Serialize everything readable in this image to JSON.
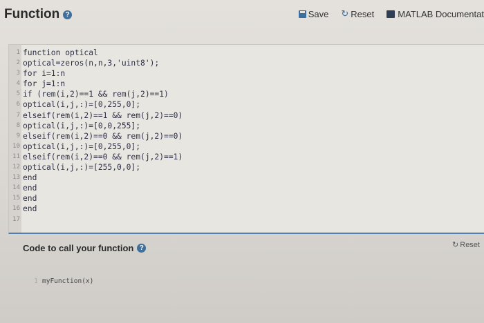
{
  "header": {
    "title": "Function",
    "save_label": "Save",
    "reset_label": "Reset",
    "doc_label": "MATLAB Documentat"
  },
  "editor": {
    "lines": [
      {
        "num": "1",
        "code": "function optical"
      },
      {
        "num": "2",
        "code": "optical=zeros(n,n,3,'uint8');"
      },
      {
        "num": "3",
        "code": "for i=1:n"
      },
      {
        "num": "4",
        "code": "for j=1:n"
      },
      {
        "num": "5",
        "code": "if (rem(i,2)==1 && rem(j,2)==1)"
      },
      {
        "num": "6",
        "code": "optical(i,j,:)=[0,255,0];"
      },
      {
        "num": "7",
        "code": "elseif(rem(i,2)==1 && rem(j,2)==0)"
      },
      {
        "num": "8",
        "code": "optical(i,j,:)=[0,0,255];"
      },
      {
        "num": "9",
        "code": "elseif(rem(i,2)==0 && rem(j,2)==0)"
      },
      {
        "num": "10",
        "code": "optical(i,j,:)=[0,255,0];"
      },
      {
        "num": "11",
        "code": "elseif(rem(i,2)==0 && rem(j,2)==1)"
      },
      {
        "num": "12",
        "code": "optical(i,j,:)=[255,0,0];"
      },
      {
        "num": "13",
        "code": "end"
      },
      {
        "num": "14",
        "code": "end"
      },
      {
        "num": "15",
        "code": "end"
      },
      {
        "num": "16",
        "code": "end"
      },
      {
        "num": "17",
        "code": ""
      }
    ]
  },
  "call": {
    "heading": "Code to call your function",
    "reset_label": "Reset",
    "line_num": "1",
    "code": "myFunction(x)"
  }
}
